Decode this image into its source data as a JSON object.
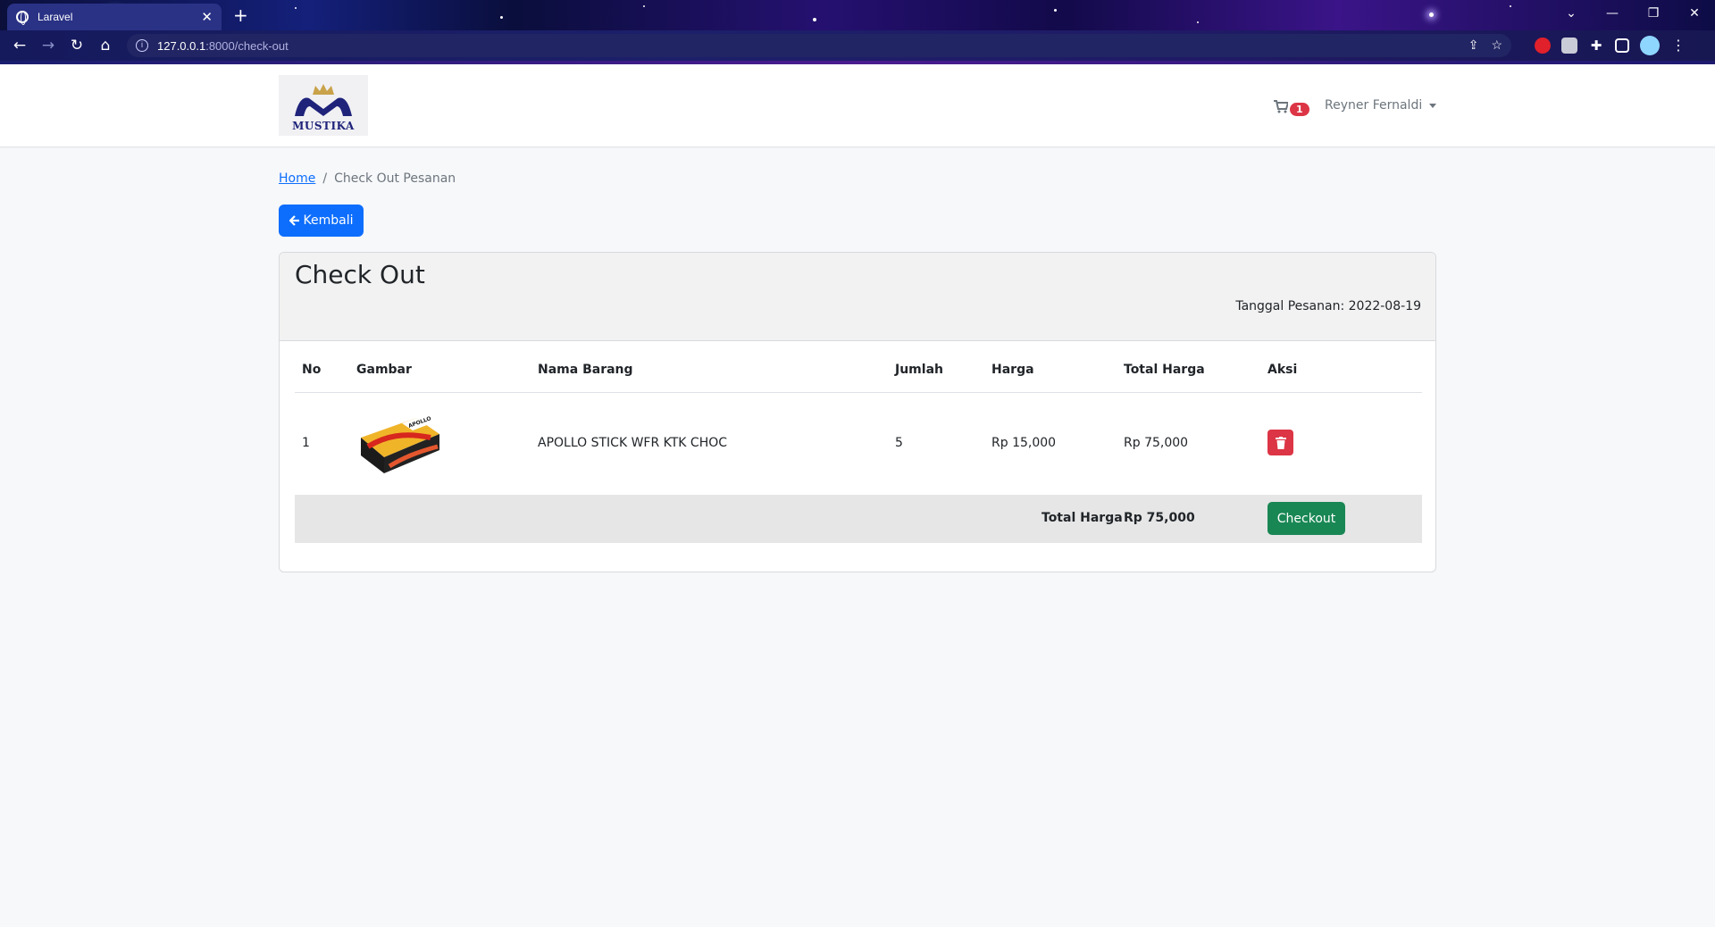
{
  "browser": {
    "tab_title": "Laravel",
    "url_host": "127.0.0.1",
    "url_path": ":8000/check-out"
  },
  "navbar": {
    "logo_text": "MUSTIKA",
    "cart_count": "1",
    "user_name": "Reyner Fernaldi"
  },
  "breadcrumb": {
    "home": "Home",
    "separator": "/",
    "current": "Check Out Pesanan"
  },
  "back_button": "Kembali",
  "card": {
    "title": "Check Out",
    "order_date": "Tanggal Pesanan: 2022-08-19"
  },
  "table": {
    "headers": {
      "no": "No",
      "image": "Gambar",
      "name": "Nama Barang",
      "qty": "Jumlah",
      "price": "Harga",
      "total": "Total Harga",
      "action": "Aksi"
    },
    "rows": [
      {
        "no": "1",
        "image_label": "APOLLO",
        "name": "APOLLO STICK WFR KTK CHOC",
        "qty": "5",
        "price": "Rp 15,000",
        "total": "Rp 75,000"
      }
    ],
    "footer": {
      "label": "Total Harga",
      "value": "Rp 75,000",
      "checkout": "Checkout"
    }
  },
  "colors": {
    "primary": "#0d6efd",
    "danger": "#dc3545",
    "success": "#198754",
    "brand": "#1f237a",
    "crown": "#c9a24a"
  }
}
